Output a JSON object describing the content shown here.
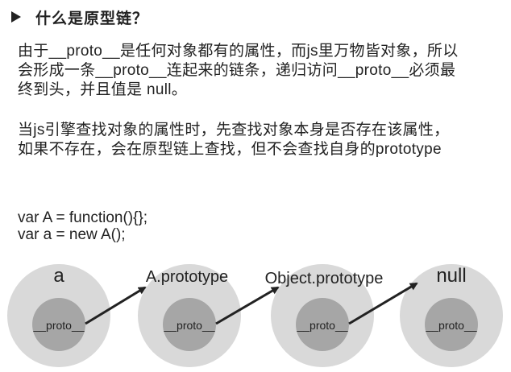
{
  "heading": {
    "title": "什么是原型链？"
  },
  "paragraph1": {
    "lines": [
      "由于__proto__是任何对象都有的属性，而js里万物皆对象，所以",
      "会形成一条__proto__连起来的链条，递归访问__proto__必须最",
      "终到头，并且值是 null。"
    ]
  },
  "paragraph2": {
    "lines": [
      "当js引擎查找对象的属性时，先查找对象本身是否存在该属性，",
      "如果不存在，会在原型链上查找，但不会查找自身的prototype"
    ]
  },
  "code": {
    "lines": [
      "var A = function(){};",
      "var a = new A();"
    ]
  },
  "diagram": {
    "nodes": [
      {
        "label": "a",
        "inner": "__proto__"
      },
      {
        "label": "A.prototype",
        "inner": "__proto__"
      },
      {
        "label": "Object.prototype",
        "inner": "__proto__"
      },
      {
        "label": "null",
        "inner": "__proto__"
      }
    ],
    "colors": {
      "outer": "#d9d9d9",
      "inner": "#a6a6a6",
      "arrow": "#222222",
      "text": "#222222"
    }
  }
}
